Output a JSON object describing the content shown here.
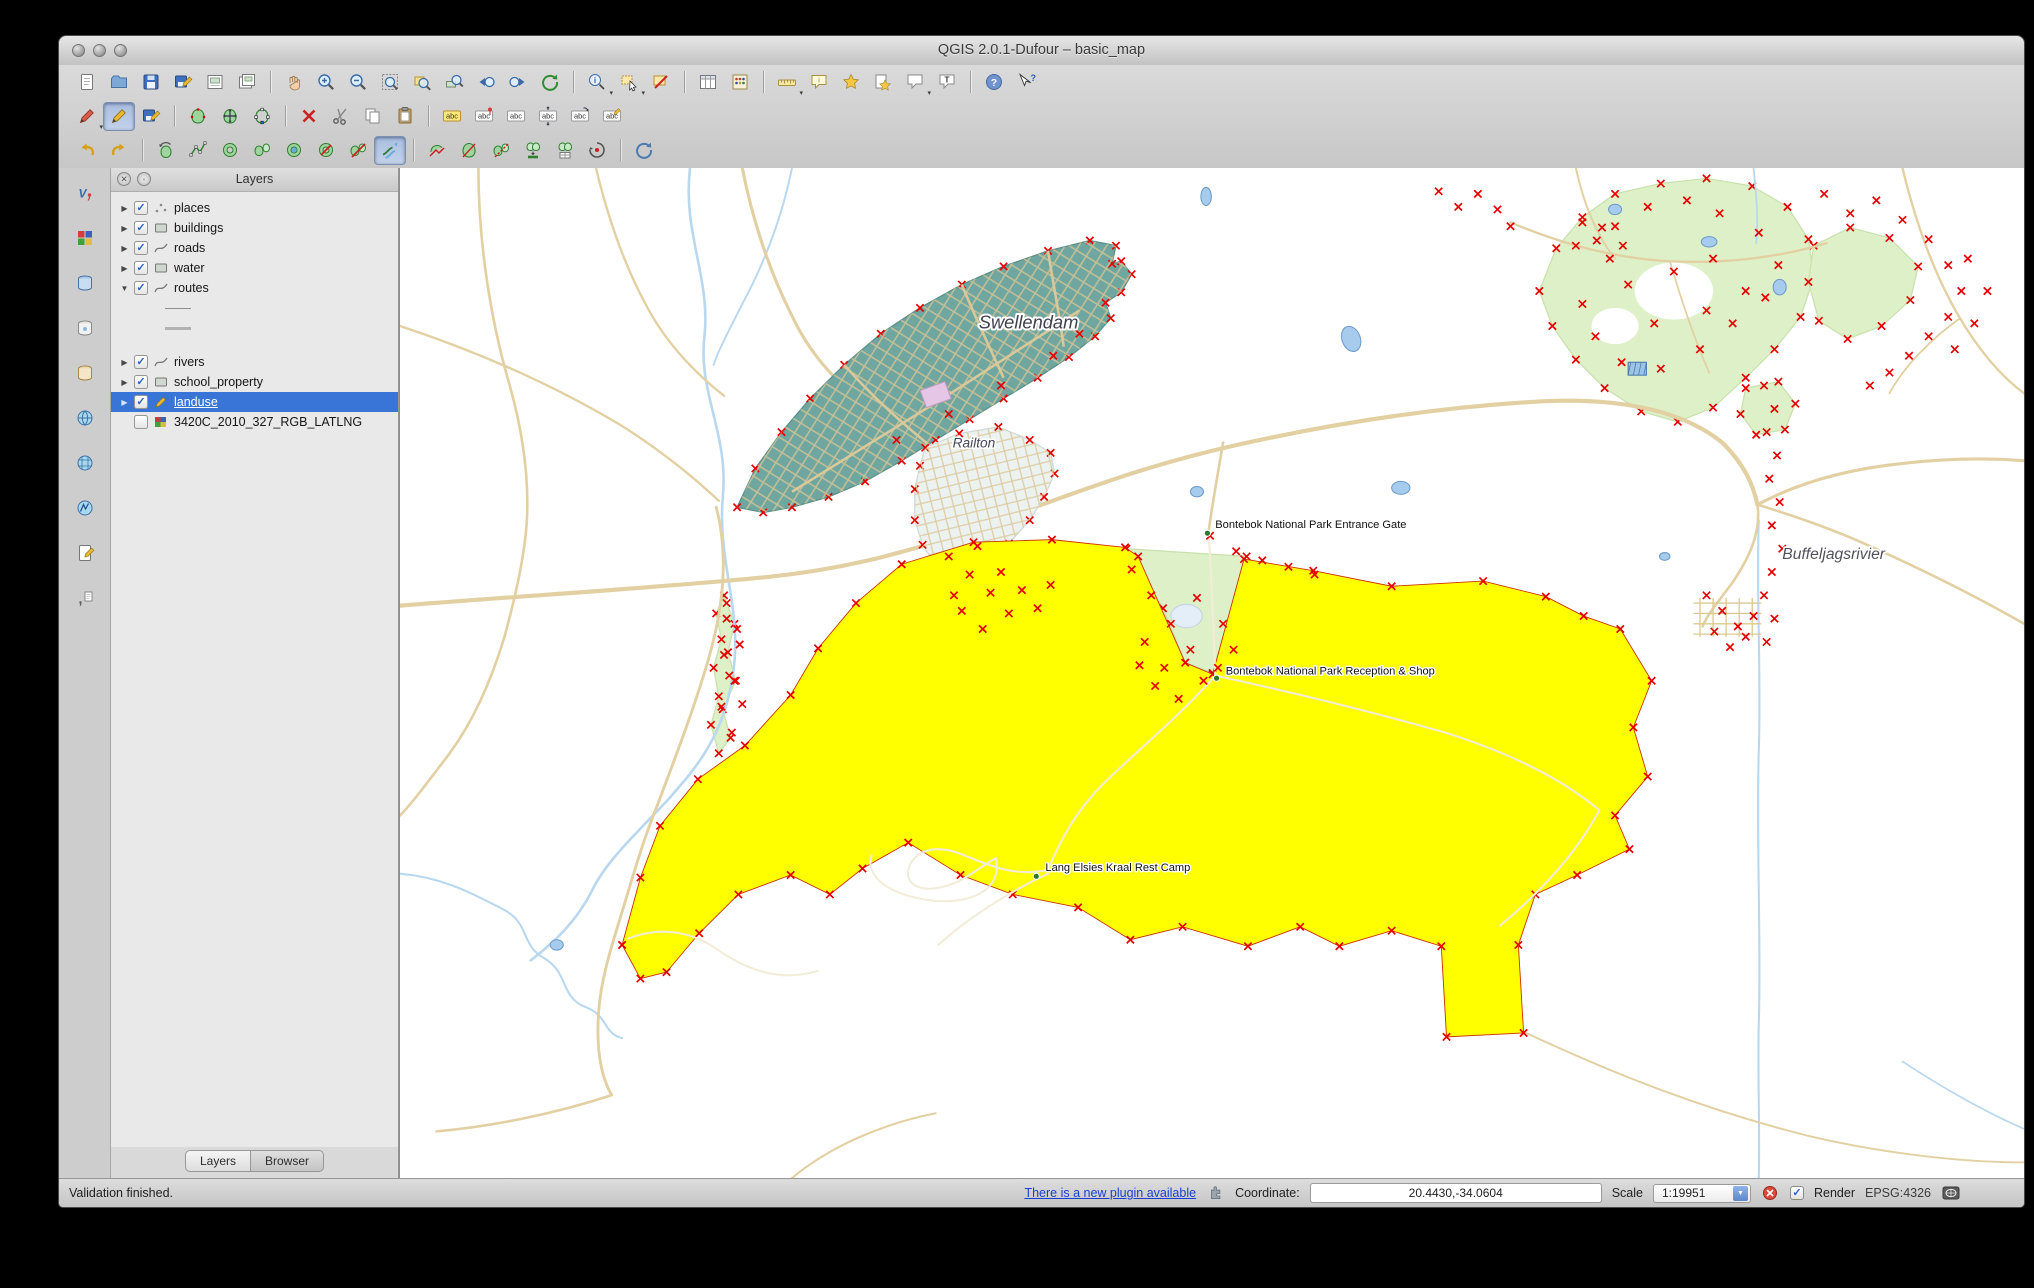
{
  "window": {
    "title": "QGIS 2.0.1-Dufour – basic_map"
  },
  "glyphs": {
    "check": "✓",
    "dropdown": "▾",
    "twisty_open": "▼",
    "twisty_closed": "▶",
    "panel_close": "✕",
    "panel_float": "◦",
    "combo_arrow": "▼"
  },
  "panel": {
    "title": "Layers",
    "tabs": [
      {
        "label": "Layers",
        "active": true
      },
      {
        "label": "Browser",
        "active": false
      }
    ],
    "layers": [
      {
        "label": "places",
        "checked": true,
        "icon": "point",
        "twisty": "right"
      },
      {
        "label": "buildings",
        "checked": true,
        "icon": "polygon",
        "twisty": "right"
      },
      {
        "label": "roads",
        "checked": true,
        "icon": "line",
        "twisty": "right"
      },
      {
        "label": "water",
        "checked": true,
        "icon": "polygon",
        "twisty": "right"
      },
      {
        "label": "routes",
        "checked": true,
        "icon": "line",
        "twisty": "down"
      },
      {
        "type": "swatch",
        "style": "thin"
      },
      {
        "type": "swatch",
        "style": "thick"
      },
      {
        "type": "gap"
      },
      {
        "label": "rivers",
        "checked": true,
        "icon": "line",
        "twisty": "right"
      },
      {
        "label": "school_property",
        "checked": true,
        "icon": "polygon",
        "twisty": "right"
      },
      {
        "label": "landuse",
        "checked": true,
        "icon": "pencil",
        "twisty": "right",
        "selected": true
      },
      {
        "label": "3420C_2010_327_RGB_LATLNG",
        "checked": false,
        "icon": "raster",
        "twisty": "none"
      }
    ]
  },
  "toolbars": {
    "row1": [
      {
        "name": "new-project",
        "icon": "page"
      },
      {
        "name": "open-project",
        "icon": "folder"
      },
      {
        "name": "save-project",
        "icon": "disk"
      },
      {
        "name": "save-project-as",
        "icon": "diskpen"
      },
      {
        "name": "new-print-composer",
        "icon": "composer"
      },
      {
        "name": "composer-manager",
        "icon": "composers"
      },
      {
        "sep": true
      },
      {
        "name": "pan-map",
        "icon": "hand"
      },
      {
        "name": "zoom-in",
        "icon": "zoomin"
      },
      {
        "name": "zoom-out",
        "icon": "zoomout"
      },
      {
        "name": "zoom-full",
        "icon": "zoomfull"
      },
      {
        "name": "zoom-to-selection",
        "icon": "zoomsel"
      },
      {
        "name": "zoom-to-layer",
        "icon": "zoomlayer"
      },
      {
        "name": "zoom-last",
        "icon": "zoomlast"
      },
      {
        "name": "zoom-next",
        "icon": "zoomnext"
      },
      {
        "name": "refresh-map",
        "icon": "refresh"
      },
      {
        "sep": true
      },
      {
        "name": "identify-features",
        "icon": "identify",
        "dd": true
      },
      {
        "name": "select-features",
        "icon": "selectrect",
        "dd": true
      },
      {
        "name": "deselect-features",
        "icon": "deselect"
      },
      {
        "sep": true
      },
      {
        "name": "open-attribute-table",
        "icon": "table"
      },
      {
        "name": "field-calculator",
        "icon": "calc"
      },
      {
        "sep": true
      },
      {
        "name": "measure",
        "icon": "measure",
        "dd": true
      },
      {
        "name": "map-tips",
        "icon": "maptips"
      },
      {
        "name": "new-bookmark",
        "icon": "bookmark"
      },
      {
        "name": "show-bookmarks",
        "icon": "bookmarks"
      },
      {
        "name": "annotation",
        "icon": "annot",
        "dd": true
      },
      {
        "name": "text-annotation",
        "icon": "textannot"
      },
      {
        "sep": true
      },
      {
        "name": "help",
        "icon": "help"
      },
      {
        "name": "whats-this",
        "icon": "whatsthis"
      }
    ],
    "row2": [
      {
        "name": "current-edits",
        "icon": "pencilred",
        "dd": true
      },
      {
        "name": "toggle-editing",
        "icon": "pencil",
        "active": true
      },
      {
        "name": "save-layer-edits",
        "icon": "savedits"
      },
      {
        "sep": true
      },
      {
        "name": "add-feature",
        "icon": "blob"
      },
      {
        "name": "move-feature",
        "icon": "movefeat"
      },
      {
        "name": "node-tool",
        "icon": "nodetool"
      },
      {
        "sep": true
      },
      {
        "name": "delete-selected",
        "icon": "delsel"
      },
      {
        "name": "cut-features",
        "icon": "cut"
      },
      {
        "name": "copy-features",
        "icon": "copy"
      },
      {
        "name": "paste-features",
        "icon": "paste"
      },
      {
        "sep": true
      },
      {
        "name": "labeling",
        "icon": "abchl"
      },
      {
        "name": "pin-labels",
        "icon": "abcpin"
      },
      {
        "name": "show-hidden-labels",
        "icon": "abc"
      },
      {
        "name": "move-label",
        "icon": "abcmove"
      },
      {
        "name": "rotate-label",
        "icon": "abcrotate"
      },
      {
        "name": "change-label",
        "icon": "abcchange"
      }
    ],
    "row3": [
      {
        "name": "undo",
        "icon": "undo"
      },
      {
        "name": "redo",
        "icon": "redo"
      },
      {
        "sep": true
      },
      {
        "name": "rotate-feature",
        "icon": "rotatefeat"
      },
      {
        "name": "simplify-feature",
        "icon": "simplify"
      },
      {
        "name": "add-ring",
        "icon": "addring"
      },
      {
        "name": "add-part",
        "icon": "addpart"
      },
      {
        "name": "fill-ring",
        "icon": "fillring"
      },
      {
        "name": "delete-ring",
        "icon": "delring"
      },
      {
        "name": "delete-part",
        "icon": "delpart"
      },
      {
        "name": "offset-curve",
        "icon": "offsetcurve",
        "active": true
      },
      {
        "sep": true
      },
      {
        "name": "reshape-features",
        "icon": "reshape"
      },
      {
        "name": "split-features",
        "icon": "splitfeat"
      },
      {
        "name": "split-parts",
        "icon": "splitparts"
      },
      {
        "name": "merge-features",
        "icon": "mergefeat"
      },
      {
        "name": "merge-attributes",
        "icon": "mergeattr"
      },
      {
        "name": "rotate-point-symbols",
        "icon": "rotatepoint"
      },
      {
        "sep": true
      },
      {
        "name": "synchronize",
        "icon": "sync"
      }
    ],
    "side": [
      {
        "name": "add-vector-layer",
        "icon": "vlayer"
      },
      {
        "name": "add-raster-layer",
        "icon": "rasterlayer"
      },
      {
        "name": "add-postgis-layer",
        "icon": "db"
      },
      {
        "name": "add-spatialite-layer",
        "icon": "spatialite"
      },
      {
        "name": "add-mssql-layer",
        "icon": "mssqldb"
      },
      {
        "name": "add-wms-layer",
        "icon": "wms"
      },
      {
        "name": "add-wcs-layer",
        "icon": "wcs"
      },
      {
        "name": "add-wfs-layer",
        "icon": "wfs"
      },
      {
        "name": "new-shapefile-layer",
        "icon": "newshp"
      },
      {
        "name": "add-delimited-text-layer",
        "icon": "csv"
      }
    ]
  },
  "map": {
    "labels": {
      "town": "Swellendam",
      "railton": "Railton",
      "river": "Buffeljagsrivier",
      "gate": "Bontebok National Park Entrance Gate",
      "reception": "Bontebok National Park Reception & Shop",
      "camp": "Lang Elsies Kraal Rest Camp"
    },
    "colors": {
      "landuse": "#ffff00",
      "urban": "#6fa7a0",
      "vegetation": "#def0c8",
      "vertex_marker": "#e60000"
    }
  },
  "statusbar": {
    "validation": "Validation finished.",
    "plugin_link": "There is a new plugin available",
    "coordinate_label": "Coordinate:",
    "coordinate_value": "20.4430,-34.0604",
    "scale_label": "Scale",
    "scale_value": "1:19951",
    "render_label": "Render",
    "epsg": "EPSG:4326"
  }
}
